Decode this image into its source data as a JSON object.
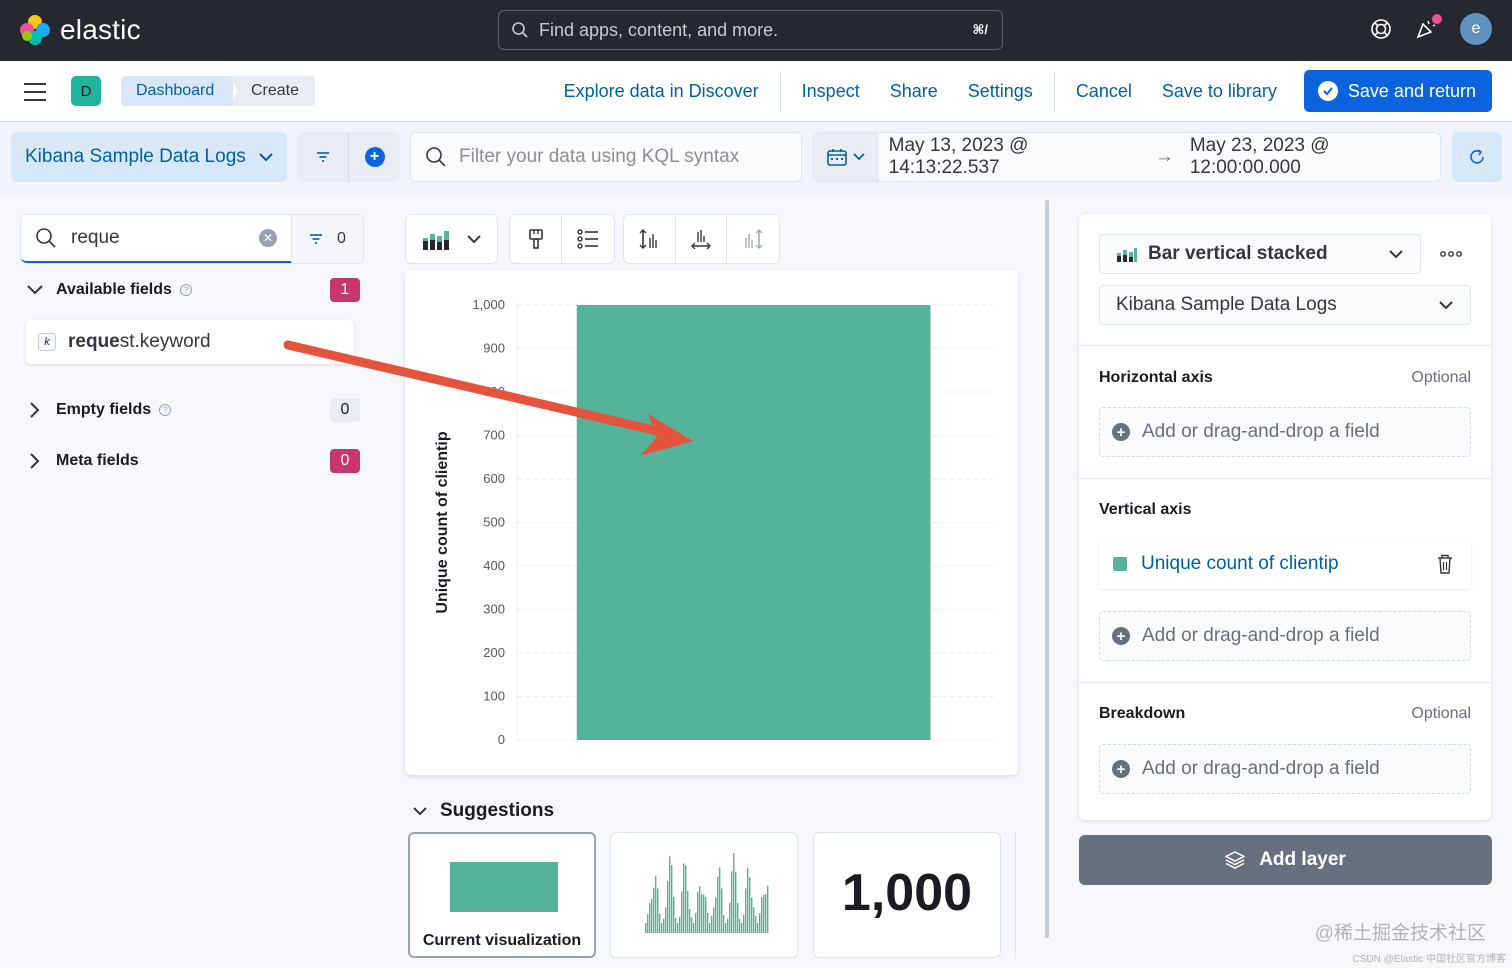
{
  "app": {
    "logo_text": "elastic",
    "search_placeholder": "Find apps, content, and more.",
    "search_shortcut": "⌘/",
    "avatar_initial": "e"
  },
  "header": {
    "space_initial": "D",
    "breadcrumbs": [
      "Dashboard",
      "Create"
    ],
    "links": {
      "explore": "Explore data in Discover",
      "inspect": "Inspect",
      "share": "Share",
      "settings": "Settings",
      "cancel": "Cancel",
      "save_library": "Save to library",
      "save_return": "Save and return"
    }
  },
  "query": {
    "data_view": "Kibana Sample Data Logs",
    "kql_placeholder": "Filter your data using KQL syntax",
    "date_start": "May 13, 2023 @ 14:13:22.537",
    "date_arrow": "→",
    "date_end": "May 23, 2023 @ 12:00:00.000"
  },
  "fields": {
    "search_value": "reque",
    "filter_count": "0",
    "available_label": "Available fields",
    "available_count": "1",
    "field_token": "k",
    "field_match": "reque",
    "field_rest": "st.keyword",
    "empty_label": "Empty fields",
    "empty_count": "0",
    "meta_label": "Meta fields",
    "meta_count": "0"
  },
  "chart_data": {
    "type": "bar",
    "categories": [
      ""
    ],
    "series": [
      {
        "values": [
          1000
        ]
      }
    ],
    "ylabel": "Unique count of clientip",
    "ylim": [
      0,
      1000
    ],
    "yticks": [
      "0",
      "100",
      "200",
      "300",
      "400",
      "500",
      "600",
      "700",
      "800",
      "900",
      "1,000"
    ],
    "color": "#54b399",
    "grid": true
  },
  "suggestions": {
    "title": "Suggestions",
    "current_label": "Current visualization",
    "metric_value": "1,000"
  },
  "config": {
    "vis_type": "Bar vertical stacked",
    "data_view": "Kibana Sample Data Logs",
    "horizontal_label": "Horizontal axis",
    "optional": "Optional",
    "add_field": "Add or drag-and-drop a field",
    "vertical_label": "Vertical axis",
    "vertical_field": "Unique count of clientip",
    "breakdown_label": "Breakdown",
    "add_layer": "Add layer"
  },
  "watermark": {
    "main": "@稀土掘金技术社区",
    "sub": "CSDN @Elastic 中国社区官方博客"
  }
}
